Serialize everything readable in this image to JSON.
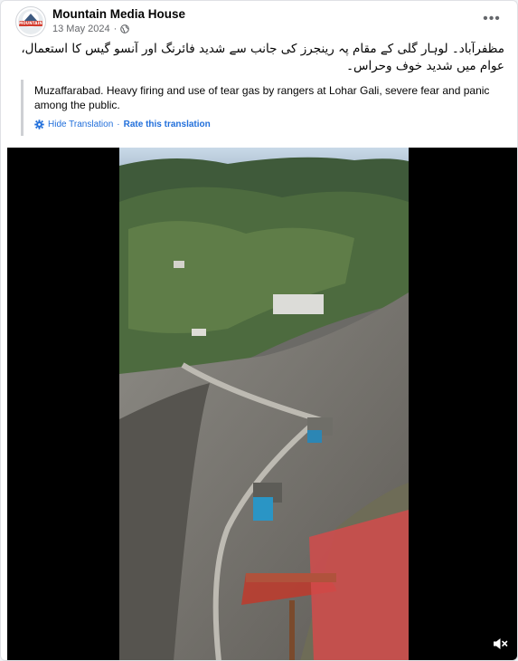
{
  "post": {
    "page_name": "Mountain Media House",
    "date": "13 May 2024",
    "separator": "·",
    "more_label": "•••",
    "avatar_label": "MOUNTAIN",
    "urdu_text": "مظفرآباد۔ لوہار گلی کے مقام پہ رینجرز کی جانب سے شدید فائرنگ اور آنسو گیس کا استعمال، عوام میں شدید خوف وحراس۔",
    "translation_text": "Muzaffarabad. Heavy firing and use of tear gas by rangers at Lohar Gali, severe fear and panic among the public.",
    "hide_translation": "Hide Translation",
    "link_separator": "·",
    "rate_translation": "Rate this translation"
  },
  "colors": {
    "link": "#216fdb",
    "muted": "#65676b",
    "video_bg": "#000000"
  },
  "icons": {
    "privacy": "globe-icon",
    "translate": "gear-icon",
    "more": "more-options-icon",
    "audio": "speaker-muted-icon"
  }
}
